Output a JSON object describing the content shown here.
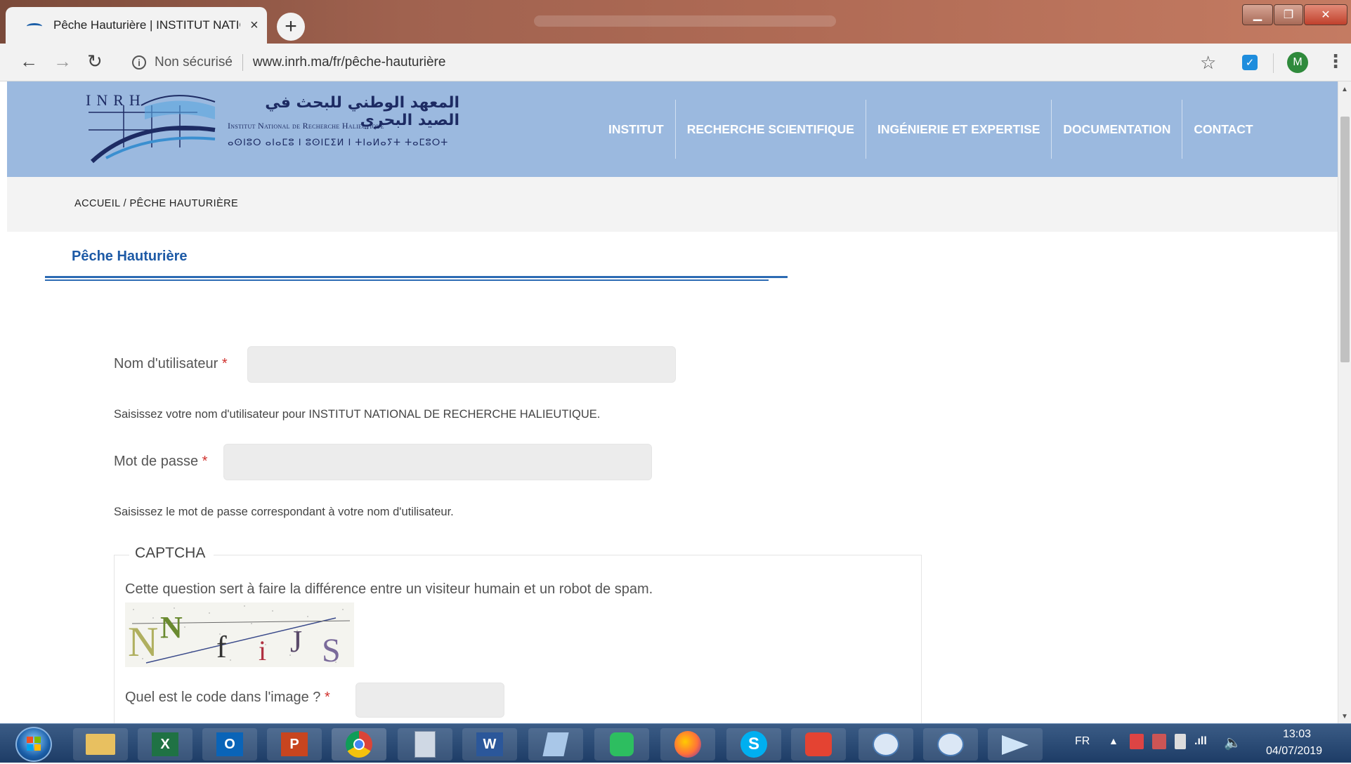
{
  "browser": {
    "tab_title": "Pêche Hauturière | INSTITUT NATIONAL DE RECHERCHE HALIEUTIQUE",
    "tab_close": "×",
    "new_tab": "+",
    "window_min": "▁",
    "window_max": "❐",
    "window_close": "✕",
    "back": "←",
    "forward": "→",
    "reload": "↻",
    "security_label": "Non sécurisé",
    "url": "www.inrh.ma/fr/pêche-hauturière",
    "bookmark_star": "☆",
    "avatar_letter": "M",
    "menu": "⋮"
  },
  "site": {
    "logo": {
      "inrh": "INRH",
      "arabic": "المعهد الوطني للبحث في الصيد البحري",
      "french": "Institut National de Recherche Halieutique",
      "tifinagh": "ⴰⵙⵏⵓⵔ ⴰⵏⴰⵎⵓ ⵏ ⵓⵙⵏⵎⵉⵍ ⵏ ⵜⵏⴰⵍⴰⵢⵜ ⵜⴰⵎⵓⵔⵜ"
    },
    "nav": [
      "INSTITUT",
      "RECHERCHE SCIENTIFIQUE",
      "INGÉNIERIE ET EXPERTISE",
      "DOCUMENTATION",
      "CONTACT"
    ],
    "breadcrumb": {
      "home": "ACCUEIL",
      "separator": "/",
      "current": "PÊCHE HAUTURIÈRE"
    },
    "page_title": "Pêche Hauturière"
  },
  "form": {
    "username_label": "Nom d'utilisateur",
    "required_mark": "*",
    "username_value": "",
    "username_help": "Saisissez votre nom d'utilisateur pour INSTITUT NATIONAL DE RECHERCHE HALIEUTIQUE.",
    "password_label": "Mot de passe",
    "password_value": "",
    "password_help": "Saisissez le mot de passe correspondant à votre nom d'utilisateur.",
    "captcha_legend": "CAPTCHA",
    "captcha_description": "Cette question sert à faire la différence entre un visiteur humain et un robot de spam.",
    "captcha_image_text": "NNfiJS",
    "captcha_question": "Quel est le code dans l'image ?",
    "captcha_value": ""
  },
  "taskbar": {
    "language": "FR",
    "time": "13:03",
    "date": "04/07/2019",
    "apps": [
      "start",
      "explorer",
      "excel",
      "outlook",
      "powerpoint",
      "chrome",
      "calculator",
      "word",
      "notepad",
      "evernote",
      "firefox",
      "skype",
      "todoist",
      "mail1",
      "mail2",
      "telegram"
    ]
  },
  "colors": {
    "header_bg": "#9bb9df",
    "title_blue": "#1d5aa6",
    "required_red": "#d0312d",
    "taskbar": "#1d3c66"
  }
}
